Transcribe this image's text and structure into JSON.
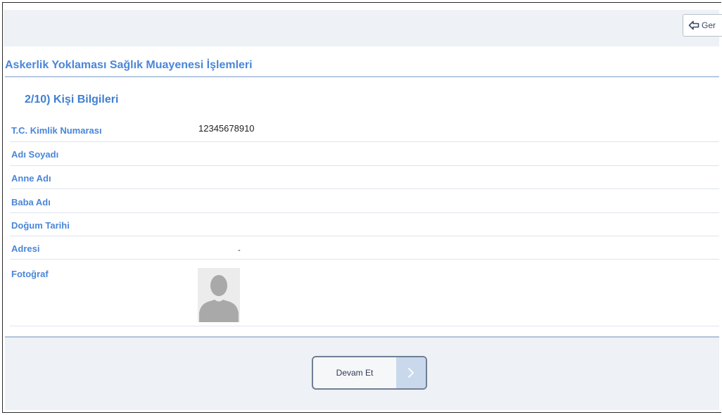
{
  "toolbar": {
    "back_label": "Ger"
  },
  "page": {
    "title": "Askerlik Yoklaması Sağlık Muayenesi İşlemleri",
    "section_title": "2/10) Kişi Bilgileri"
  },
  "fields": {
    "tc": {
      "label": "T.C. Kimlik Numarası",
      "value": "12345678910"
    },
    "name": {
      "label": "Adı Soyadı",
      "value": ""
    },
    "mother": {
      "label": "Anne Adı",
      "value": ""
    },
    "father": {
      "label": "Baba Adı",
      "value": ""
    },
    "birth": {
      "label": "Doğum Tarihi",
      "value": ""
    },
    "address": {
      "label": "Adresi",
      "value": "-"
    },
    "photo": {
      "label": "Fotoğraf"
    }
  },
  "footer": {
    "continue_label": "Devam Et"
  },
  "icons": {
    "back": "back-arrow-icon",
    "continue": "chevron-right-icon",
    "photo_placeholder": "person-silhouette-icon"
  },
  "colors": {
    "accent_blue": "#4a86d8",
    "panel_bg": "#eef1f5",
    "button_accent": "#c9d9eb"
  }
}
